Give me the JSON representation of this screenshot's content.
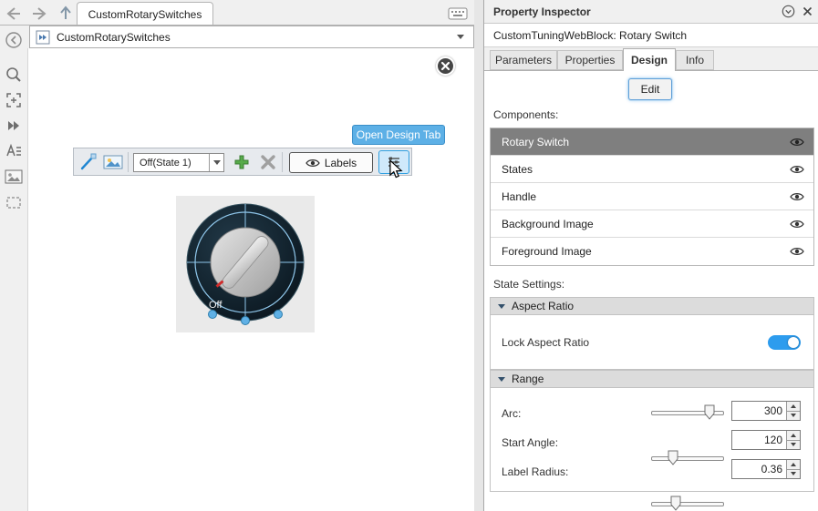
{
  "document_tab": {
    "title": "CustomRotarySwitches"
  },
  "breadcrumb": {
    "model": "CustomRotarySwitches"
  },
  "canvas": {
    "tooltip": "Open Design Tab",
    "design_toolbar": {
      "state_selector": {
        "value": "Off(State 1)"
      },
      "labels_button": "Labels"
    },
    "rotary_switch": {
      "state_label": "Off"
    }
  },
  "property_inspector": {
    "title": "Property Inspector",
    "block_heading": "CustomTuningWebBlock: Rotary Switch",
    "tabs": [
      {
        "label": "Parameters",
        "active": false
      },
      {
        "label": "Properties",
        "active": false
      },
      {
        "label": "Design",
        "active": true
      },
      {
        "label": "Info",
        "active": false
      }
    ],
    "edit_button": "Edit",
    "components_label": "Components:",
    "components": [
      {
        "label": "Rotary Switch",
        "selected": true
      },
      {
        "label": "States",
        "selected": false
      },
      {
        "label": "Handle",
        "selected": false
      },
      {
        "label": "Background Image",
        "selected": false
      },
      {
        "label": "Foreground Image",
        "selected": false
      }
    ],
    "state_settings_label": "State Settings:",
    "aspect_ratio_section": {
      "title": "Aspect Ratio",
      "lock_label": "Lock Aspect Ratio",
      "lock_enabled": true
    },
    "range_section": {
      "title": "Range",
      "rows": [
        {
          "label": "Arc:",
          "value": "300",
          "slider_percent": 80
        },
        {
          "label": "Start Angle:",
          "value": "120",
          "slider_percent": 30
        },
        {
          "label": "Label Radius:",
          "value": "0.36",
          "slider_percent": 34
        }
      ]
    }
  },
  "colors": {
    "selection_blue": "#8fc6ea",
    "toggle_blue": "#2d9cee",
    "tooltip_blue": "#5db0e6",
    "add_green": "#57ab4a",
    "dial_dark": "#13242f"
  },
  "icons": [
    "back-icon",
    "forward-icon",
    "up-icon",
    "keyboard-icon",
    "block-icon",
    "dropdown-caret-icon",
    "hide-browser-icon",
    "zoom-icon",
    "fit-to-view-icon",
    "step-forward-icon",
    "annotation-icon",
    "image-icon",
    "area-icon",
    "close-icon",
    "line-tool-icon",
    "image-tool-icon",
    "add-state-icon",
    "delete-state-icon",
    "eye-icon",
    "design-tab-icon",
    "cursor-icon",
    "panel-menu-icon",
    "panel-close-icon"
  ]
}
